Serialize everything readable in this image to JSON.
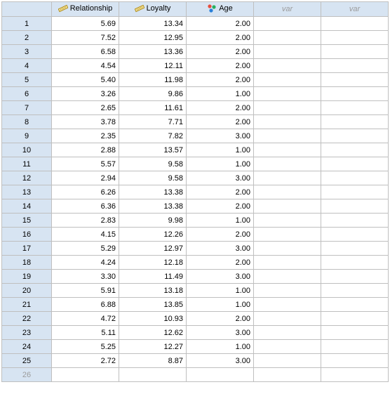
{
  "chart_data": {
    "type": "table",
    "columns": [
      "Relationship",
      "Loyalty",
      "Age"
    ],
    "rows": [
      [
        5.69,
        13.34,
        2.0
      ],
      [
        7.52,
        12.95,
        2.0
      ],
      [
        6.58,
        13.36,
        2.0
      ],
      [
        4.54,
        12.11,
        2.0
      ],
      [
        5.4,
        11.98,
        2.0
      ],
      [
        3.26,
        9.86,
        1.0
      ],
      [
        2.65,
        11.61,
        2.0
      ],
      [
        3.78,
        7.71,
        2.0
      ],
      [
        2.35,
        7.82,
        3.0
      ],
      [
        2.88,
        13.57,
        1.0
      ],
      [
        5.57,
        9.58,
        1.0
      ],
      [
        2.94,
        9.58,
        3.0
      ],
      [
        6.26,
        13.38,
        2.0
      ],
      [
        6.36,
        13.38,
        2.0
      ],
      [
        2.83,
        9.98,
        1.0
      ],
      [
        4.15,
        12.26,
        2.0
      ],
      [
        5.29,
        12.97,
        3.0
      ],
      [
        4.24,
        12.18,
        2.0
      ],
      [
        3.3,
        11.49,
        3.0
      ],
      [
        5.91,
        13.18,
        1.0
      ],
      [
        6.88,
        13.85,
        1.0
      ],
      [
        4.72,
        10.93,
        2.0
      ],
      [
        5.11,
        12.62,
        3.0
      ],
      [
        5.25,
        12.27,
        1.0
      ],
      [
        2.72,
        8.87,
        3.0
      ]
    ]
  },
  "columns": [
    {
      "name": "Relationship",
      "icon": "ruler"
    },
    {
      "name": "Loyalty",
      "icon": "ruler"
    },
    {
      "name": "Age",
      "icon": "nominal"
    },
    {
      "name": "var",
      "icon": "none",
      "placeholder": true
    },
    {
      "name": "var",
      "icon": "none",
      "placeholder": true
    }
  ],
  "row_labels": [
    "1",
    "2",
    "3",
    "4",
    "5",
    "6",
    "7",
    "8",
    "9",
    "10",
    "11",
    "12",
    "13",
    "14",
    "15",
    "16",
    "17",
    "18",
    "19",
    "20",
    "21",
    "22",
    "23",
    "24",
    "25"
  ],
  "new_row_label": "26",
  "cells": [
    [
      "5.69",
      "13.34",
      "2.00"
    ],
    [
      "7.52",
      "12.95",
      "2.00"
    ],
    [
      "6.58",
      "13.36",
      "2.00"
    ],
    [
      "4.54",
      "12.11",
      "2.00"
    ],
    [
      "5.40",
      "11.98",
      "2.00"
    ],
    [
      "3.26",
      "9.86",
      "1.00"
    ],
    [
      "2.65",
      "11.61",
      "2.00"
    ],
    [
      "3.78",
      "7.71",
      "2.00"
    ],
    [
      "2.35",
      "7.82",
      "3.00"
    ],
    [
      "2.88",
      "13.57",
      "1.00"
    ],
    [
      "5.57",
      "9.58",
      "1.00"
    ],
    [
      "2.94",
      "9.58",
      "3.00"
    ],
    [
      "6.26",
      "13.38",
      "2.00"
    ],
    [
      "6.36",
      "13.38",
      "2.00"
    ],
    [
      "2.83",
      "9.98",
      "1.00"
    ],
    [
      "4.15",
      "12.26",
      "2.00"
    ],
    [
      "5.29",
      "12.97",
      "3.00"
    ],
    [
      "4.24",
      "12.18",
      "2.00"
    ],
    [
      "3.30",
      "11.49",
      "3.00"
    ],
    [
      "5.91",
      "13.18",
      "1.00"
    ],
    [
      "6.88",
      "13.85",
      "1.00"
    ],
    [
      "4.72",
      "10.93",
      "2.00"
    ],
    [
      "5.11",
      "12.62",
      "3.00"
    ],
    [
      "5.25",
      "12.27",
      "1.00"
    ],
    [
      "2.72",
      "8.87",
      "3.00"
    ]
  ]
}
